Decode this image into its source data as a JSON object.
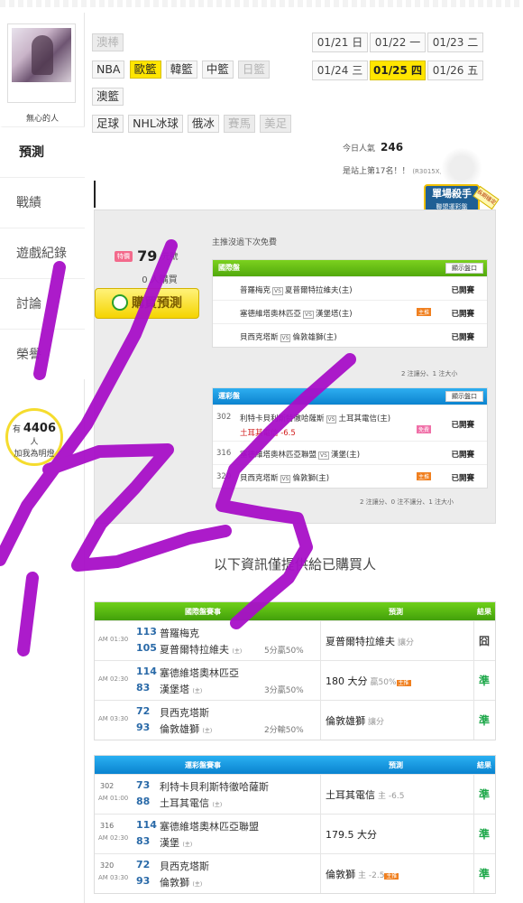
{
  "sidebar": {
    "username": "無心的人",
    "nav": [
      "預測",
      "戰績",
      "遊戲紀錄",
      "討論",
      "榮譽"
    ],
    "fans": {
      "prefix": "有",
      "count": "4406",
      "unit": "人",
      "cta": "加我為明燈"
    }
  },
  "leagues": [
    {
      "label": "澳棒",
      "state": "off"
    },
    {
      "label": "NBA",
      "state": "normal"
    },
    {
      "label": "歐籃",
      "state": "on"
    },
    {
      "label": "韓籃",
      "state": "normal"
    },
    {
      "label": "中籃",
      "state": "normal"
    },
    {
      "label": "日籃",
      "state": "off"
    },
    {
      "label": "澳籃",
      "state": "normal"
    },
    {
      "label": "足球",
      "state": "normal"
    },
    {
      "label": "NHL冰球",
      "state": "normal"
    },
    {
      "label": "俄冰",
      "state": "normal"
    },
    {
      "label": "賽馬",
      "state": "off"
    },
    {
      "label": "美足",
      "state": "off"
    }
  ],
  "dates": [
    {
      "label": "01/21 日",
      "active": false
    },
    {
      "label": "01/22 一",
      "active": false
    },
    {
      "label": "01/23 二",
      "active": false
    },
    {
      "label": "01/24 三",
      "active": false
    },
    {
      "label": "01/25 四",
      "active": true
    },
    {
      "label": "01/26 五",
      "active": false
    }
  ],
  "popularity": {
    "label": "今日人氣",
    "value": "246"
  },
  "rank": {
    "text": "是站上第17名！！",
    "sub": "(R3015X)"
  },
  "badge": {
    "title": "單場殺手",
    "subtitle": "聯盟運彩盤",
    "tag": "長期穩定"
  },
  "purchase": {
    "hot": "特價",
    "price": "79",
    "unit": "元號",
    "buyers": "0 人購買",
    "button": "購買預測",
    "next_free": "主推沒過下次免費"
  },
  "intl_small": {
    "title": "國際盤",
    "show_button": "顯示盤口",
    "rows": [
      {
        "home": "普羅梅克",
        "away": "夏普爾特拉維夫(主)",
        "tag": "",
        "result": "已開賽"
      },
      {
        "home": "塞德維塔奧林匹亞",
        "away": "漢堡塔(主)",
        "tag": "主推",
        "result": "已開賽"
      },
      {
        "home": "貝西克塔斯",
        "away": "倫敦雄獅(主)",
        "tag": "",
        "result": "已開賽"
      }
    ],
    "stats": "2 注讓分、1 注大小"
  },
  "lottery_small": {
    "title": "運彩盤",
    "show_button": "顯示盤口",
    "rows": [
      {
        "num": "302",
        "home": "利特卡貝利斯特徹哈薩斯",
        "away": "土耳其電信(主)",
        "line2": "土耳其電信 -6.5",
        "tag": "免費",
        "result": "已開賽"
      },
      {
        "num": "316",
        "home": "塞德維塔奧林匹亞聯盟",
        "away": "漢堡(主)",
        "line2": "",
        "tag": "",
        "result": "已開賽"
      },
      {
        "num": "320",
        "home": "貝西克塔斯",
        "away": "倫敦獅(主)",
        "line2": "",
        "tag": "主推",
        "result": "已開賽"
      }
    ],
    "stats": "2 注讓分、0 注不讓分、1 注大小"
  },
  "notice": "以下資訊僅提供給已購買人",
  "intl_table": {
    "headers": [
      "國際盤賽事",
      "預測",
      "結果"
    ],
    "rows": [
      {
        "time": "AM 01:30",
        "n1": "113",
        "t1": "普羅梅克",
        "n2": "105",
        "t2": "夏普爾特拉維夫",
        "home": "(主)",
        "record": "5分贏50%",
        "pred": "夏普爾特拉維夫",
        "pred_sub": "讓分",
        "tag": "",
        "result": "囧"
      },
      {
        "time": "AM 02:30",
        "n1": "114",
        "t1": "塞德維塔奧林匹亞",
        "n2": "83",
        "t2": "漢堡塔",
        "home": "(主)",
        "record": "3分贏50%",
        "pred": "180 大分",
        "pred_sub": "贏50%",
        "tag": "主推",
        "result": "準"
      },
      {
        "time": "AM 03:30",
        "n1": "72",
        "t1": "貝西克塔斯",
        "n2": "93",
        "t2": "倫敦雄獅",
        "home": "(主)",
        "record": "2分輸50%",
        "pred": "倫敦雄獅",
        "pred_sub": "讓分",
        "tag": "",
        "result": "準"
      }
    ]
  },
  "lottery_table": {
    "headers": [
      "運彩盤賽事",
      "預測",
      "結果"
    ],
    "rows": [
      {
        "gnum": "302",
        "time": "AM 01:00",
        "n1": "73",
        "t1": "利特卡貝利斯特徹哈薩斯",
        "n2": "88",
        "t2": "土耳其電信",
        "home": "(主)",
        "pred": "土耳其電信",
        "pred_sub": "主 -6.5",
        "tag": "",
        "result": "準"
      },
      {
        "gnum": "316",
        "time": "AM 02:30",
        "n1": "114",
        "t1": "塞德維塔奧林匹亞聯盟",
        "n2": "83",
        "t2": "漢堡",
        "home": "(主)",
        "pred": "179.5 大分",
        "pred_sub": "",
        "tag": "",
        "result": "準"
      },
      {
        "gnum": "320",
        "time": "AM 03:30",
        "n1": "72",
        "t1": "貝西克塔斯",
        "n2": "93",
        "t2": "倫敦獅",
        "home": "(主)",
        "pred": "倫敦獅",
        "pred_sub": "主 -2.5",
        "tag": "主推",
        "result": "準"
      }
    ]
  },
  "colors": {
    "accent_yellow": "#ffe500",
    "green_header": "#52a90d",
    "blue_header": "#0b83cf",
    "win_green": "#1ea84a",
    "scribble": "#a80fc8"
  }
}
